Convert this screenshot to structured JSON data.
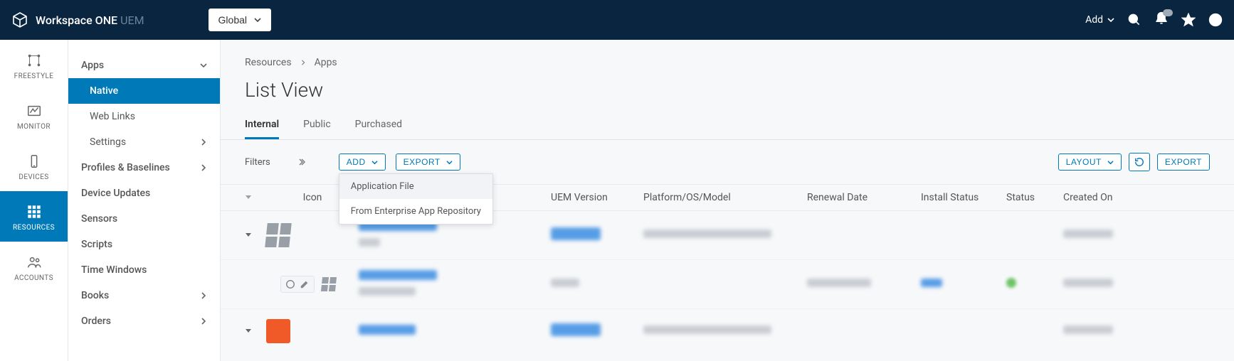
{
  "header": {
    "brand": "Workspace ONE",
    "brand_suffix": "UEM",
    "org": "Global",
    "add_label": "Add"
  },
  "rail": [
    {
      "id": "freestyle",
      "label": "FREESTYLE"
    },
    {
      "id": "monitor",
      "label": "MONITOR"
    },
    {
      "id": "devices",
      "label": "DEVICES"
    },
    {
      "id": "resources",
      "label": "RESOURCES",
      "active": true
    },
    {
      "id": "accounts",
      "label": "ACCOUNTS"
    }
  ],
  "submenu": {
    "apps": {
      "label": "Apps",
      "children": {
        "native": "Native",
        "weblinks": "Web Links",
        "settings": "Settings"
      }
    },
    "profiles": "Profiles & Baselines",
    "devupdates": "Device Updates",
    "sensors": "Sensors",
    "scripts": "Scripts",
    "timewin": "Time Windows",
    "books": "Books",
    "orders": "Orders"
  },
  "breadcrumb": {
    "a": "Resources",
    "b": "Apps"
  },
  "page_title": "List View",
  "tabs": {
    "internal": "Internal",
    "public": "Public",
    "purchased": "Purchased"
  },
  "toolbar": {
    "filters": "Filters",
    "add": "ADD",
    "export": "EXPORT",
    "layout": "LAYOUT",
    "export2": "EXPORT"
  },
  "add_menu": {
    "app_file": "Application File",
    "ear": "From Enterprise App Repository"
  },
  "columns": {
    "icon": "Icon",
    "uem": "UEM Version",
    "platform": "Platform/OS/Model",
    "renewal": "Renewal Date",
    "install": "Install Status",
    "status": "Status",
    "created": "Created On"
  }
}
